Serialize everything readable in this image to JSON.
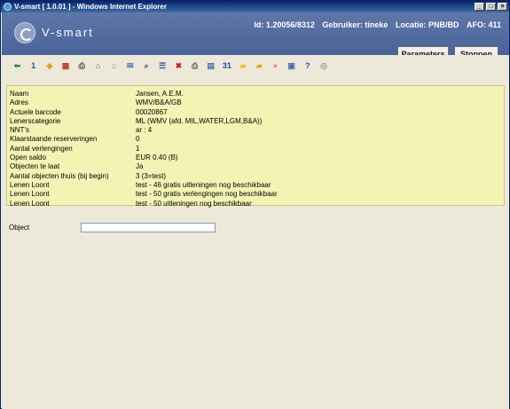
{
  "window": {
    "title": "V-smart [ 1.0.01 ] - Windows Internet Explorer",
    "minimize": "_",
    "maximize": "□",
    "close": "×"
  },
  "header": {
    "brand": "V-smart",
    "id_text": "Id: 1.20056/8312",
    "user_text": "Gebruiker: tineke",
    "location_text": "Locatie: PNB/BD",
    "afo_text": "AFO: 411",
    "parameters_label": "Parameters",
    "stop_label": "Stoppen"
  },
  "toolbar": {
    "icons": [
      {
        "name": "back-arrow-icon",
        "glyph": "⬅",
        "color": "#2e8b2e"
      },
      {
        "name": "calendar-one-icon",
        "glyph": "1",
        "color": "#1b4fa8"
      },
      {
        "name": "tag-icon",
        "glyph": "◆",
        "color": "#d9a520"
      },
      {
        "name": "books-icon",
        "glyph": "▦",
        "color": "#c0392b"
      },
      {
        "name": "printer-icon",
        "glyph": "⎙",
        "color": "#444444"
      },
      {
        "name": "house-books-icon",
        "glyph": "⌂",
        "color": "#8b5a2b"
      },
      {
        "name": "house-return-icon",
        "glyph": "⌂",
        "color": "#6a7fa8"
      },
      {
        "name": "mail-icon",
        "glyph": "✉",
        "color": "#3d6db5"
      },
      {
        "name": "search-document-icon",
        "glyph": "⌕",
        "color": "#2b4c8c"
      },
      {
        "name": "list-document-icon",
        "glyph": "☰",
        "color": "#3a5a9a"
      },
      {
        "name": "delete-icon",
        "glyph": "✖",
        "color": "#cc1b1b"
      },
      {
        "name": "print-queue-icon",
        "glyph": "⎙",
        "color": "#555555"
      },
      {
        "name": "clipboard-icon",
        "glyph": "▤",
        "color": "#4a6fb0"
      },
      {
        "name": "calendar-31-icon",
        "glyph": "31",
        "color": "#1b4fa8"
      },
      {
        "name": "note-icon",
        "glyph": "▰",
        "color": "#e5c21f"
      },
      {
        "name": "notes-icon",
        "glyph": "▰",
        "color": "#d8a51a"
      },
      {
        "name": "piggy-bank-icon",
        "glyph": "●",
        "color": "#e58aa0"
      },
      {
        "name": "screen-icon",
        "glyph": "▣",
        "color": "#4a6fb0"
      },
      {
        "name": "help-icon",
        "glyph": "?",
        "color": "#1f5bbf"
      },
      {
        "name": "users-icon",
        "glyph": "◎",
        "color": "#9a9a9a"
      }
    ]
  },
  "info": {
    "rows": [
      {
        "label": "Naam",
        "value": "Jansen, A.E.M."
      },
      {
        "label": "Adres",
        "value": "WMV/B&A/GB"
      },
      {
        "label": "Actuele barcode",
        "value": "00020867"
      },
      {
        "label": "Lenerscategorie",
        "value": "ML (WMV (afd. MIL,WATER,LGM,B&A))"
      },
      {
        "label": "NNT's",
        "value": "ar : 4"
      },
      {
        "label": "Klaarstaande reserveringen",
        "value": "0"
      },
      {
        "label": "Aantal verlengingen",
        "value": "1"
      },
      {
        "label": "Open saldo",
        "value": "EUR 0.40 (B)"
      },
      {
        "label": "Objecten te laat",
        "value": "Ja"
      },
      {
        "label": "Aantal objecten thuis (bij begin)",
        "value": "3 (3=test)"
      },
      {
        "label": "Lenen Loont",
        "value": "test - 46 gratis uitleningen nog beschikbaar"
      },
      {
        "label": "Lenen Loont",
        "value": "test - 50 gratis verlengingen nog beschikbaar"
      },
      {
        "label": "Lenen Loont",
        "value": "test - 50 uitleningen nog beschikbaar"
      }
    ]
  },
  "object_field": {
    "label": "Object",
    "value": ""
  }
}
